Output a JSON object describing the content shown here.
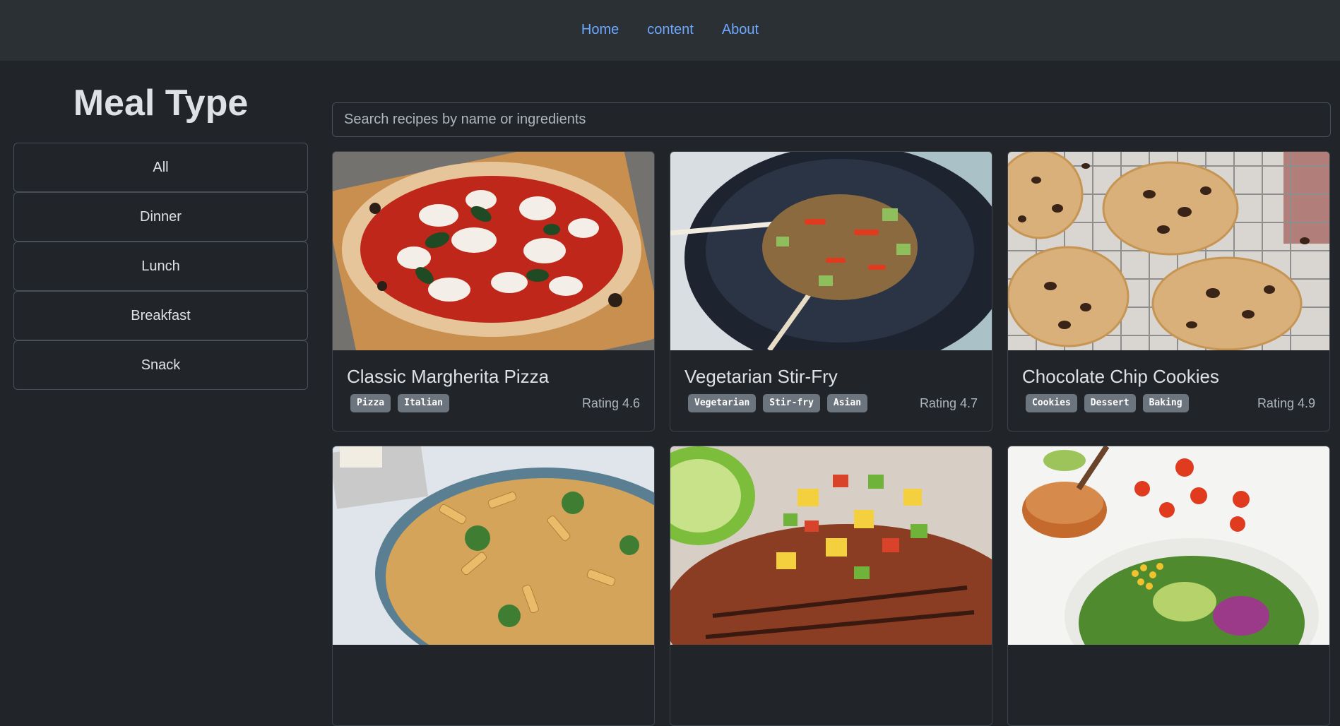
{
  "nav": {
    "links": [
      "Home",
      "content",
      "About"
    ]
  },
  "sidebar": {
    "title": "Meal Type",
    "items": [
      "All",
      "Dinner",
      "Lunch",
      "Breakfast",
      "Snack"
    ]
  },
  "search": {
    "placeholder": "Search recipes by name or ingredients",
    "value": ""
  },
  "recipes": [
    {
      "title": "Classic Margherita Pizza",
      "tags": [
        "Pizza",
        "Italian"
      ],
      "rating": "Rating 4.6",
      "image": "pizza"
    },
    {
      "title": "Vegetarian Stir-Fry",
      "tags": [
        "Vegetarian",
        "Stir-fry",
        "Asian"
      ],
      "rating": "Rating 4.7",
      "image": "stir-fry"
    },
    {
      "title": "Chocolate Chip Cookies",
      "tags": [
        "Cookies",
        "Dessert",
        "Baking"
      ],
      "rating": "Rating 4.9",
      "image": "cookies"
    },
    {
      "image": "pasta"
    },
    {
      "image": "chicken"
    },
    {
      "image": "salad"
    }
  ],
  "colors": {
    "background": "#212529",
    "nav_bg": "#2b3035",
    "link": "#6ea8fe",
    "tag_bg": "#6c757d"
  }
}
